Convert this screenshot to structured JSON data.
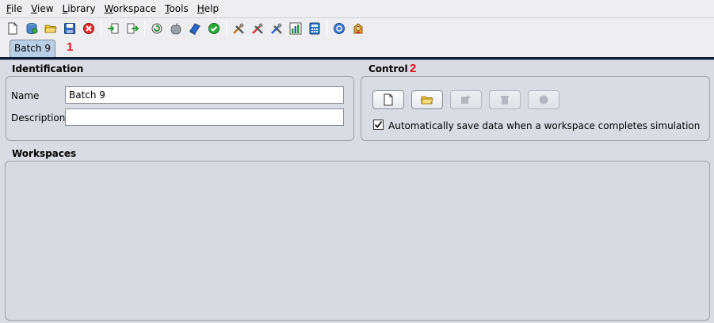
{
  "menu": {
    "file": "File",
    "view": "View",
    "library": "Library",
    "workspace": "Workspace",
    "tools": "Tools",
    "help": "Help"
  },
  "toolbar_icons": [
    "new-document-icon",
    "new-database-icon",
    "open-folder-icon",
    "save-icon",
    "close-red-icon",
    "import-icon",
    "export-icon",
    "refresh-icon",
    "apple-icon",
    "book-icon",
    "check-icon",
    "tools-icon",
    "tools-icon-2",
    "tools-icon-3",
    "chart-icon",
    "calculator-icon",
    "help-icon",
    "agent-icon"
  ],
  "tab": {
    "label": "Batch 9",
    "annotation": "1"
  },
  "identification": {
    "title": "Identification",
    "name_label": "Name",
    "name_value": "Batch 9",
    "description_label": "Description",
    "description_value": ""
  },
  "control": {
    "title": "Control",
    "annotation": "2",
    "auto_save_label": "Automatically save data when a workspace completes simulation",
    "auto_save_checked": true
  },
  "workspaces": {
    "title": "Workspaces"
  }
}
